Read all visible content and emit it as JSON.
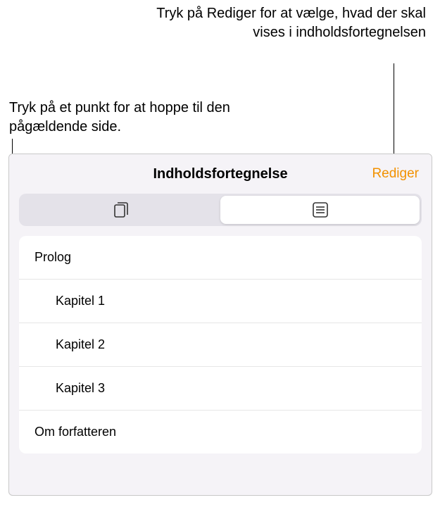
{
  "callouts": {
    "edit_hint": "Tryk på Rediger for at vælge, hvad der skal vises i indholdsfortegnelsen",
    "item_hint": "Tryk på et punkt for at hoppe til den pågældende side."
  },
  "header": {
    "title": "Indholdsfortegnelse",
    "edit_label": "Rediger"
  },
  "segments": {
    "thumbnails": "thumbnails",
    "list": "list",
    "selected": "list"
  },
  "toc": [
    {
      "label": "Prolog",
      "level": 0
    },
    {
      "label": "Kapitel 1",
      "level": 1
    },
    {
      "label": "Kapitel 2",
      "level": 1
    },
    {
      "label": "Kapitel 3",
      "level": 1
    },
    {
      "label": "Om forfatteren",
      "level": 0
    }
  ],
  "colors": {
    "accent": "#f29100"
  }
}
